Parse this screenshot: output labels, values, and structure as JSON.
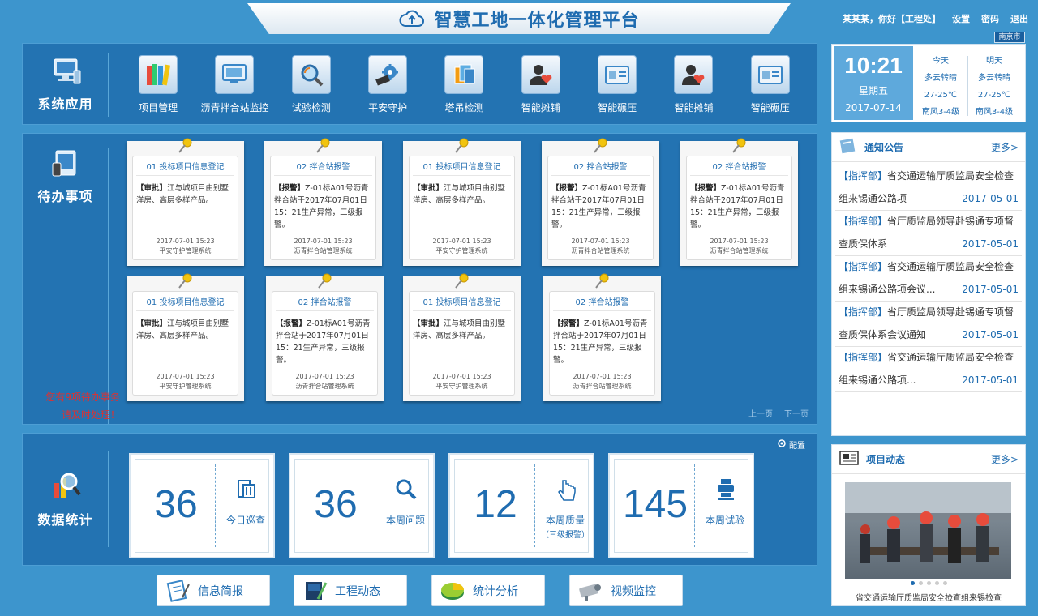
{
  "header": {
    "title": "智慧工地一体化管理平台",
    "user_greeting": "某某某，你好【工程处】",
    "settings": "设置",
    "password": "密码",
    "logout": "退出"
  },
  "apps_section": {
    "title": "系统应用",
    "items": [
      {
        "label": "项目管理",
        "icon": "books-icon"
      },
      {
        "label": "沥青拌合站监控",
        "icon": "monitor-icon"
      },
      {
        "label": "试验检测",
        "icon": "magnifier-icon"
      },
      {
        "label": "平安守护",
        "icon": "gear-icon"
      },
      {
        "label": "塔吊检测",
        "icon": "documents-icon"
      },
      {
        "label": "智能摊铺",
        "icon": "user-heart-icon"
      },
      {
        "label": "智能碾压",
        "icon": "id-card-icon"
      },
      {
        "label": "智能摊铺",
        "icon": "user-heart-icon"
      },
      {
        "label": "智能碾压",
        "icon": "id-card-icon"
      }
    ]
  },
  "todo_section": {
    "title": "待办事项",
    "pending_notice_line1": "您有9项待办事务",
    "pending_notice_line2": "请及时处理！",
    "prev_page": "上一页",
    "next_page": "下一页",
    "cards": [
      {
        "title": "01 投标项目信息登记",
        "tag": "【审批】",
        "text": "江与城项目由别墅洋房、高层多样产品。",
        "time": "2017-07-01 15:23",
        "source": "平安守护管理系统"
      },
      {
        "title": "02 拌合站报警",
        "tag": "【报警】",
        "text": "Z-01标A01号沥青拌合站于2017年07月01日 15：21生产异常，三级报警。",
        "time": "2017-07-01 15:23",
        "source": "沥青拌合站管理系统"
      },
      {
        "title": "01 投标项目信息登记",
        "tag": "【审批】",
        "text": "江与城项目由别墅洋房、高层多样产品。",
        "time": "2017-07-01 15:23",
        "source": "平安守护管理系统"
      },
      {
        "title": "02 拌合站报警",
        "tag": "【报警】",
        "text": "Z-01标A01号沥青拌合站于2017年07月01日 15：21生产异常，三级报警。",
        "time": "2017-07-01 15:23",
        "source": "沥青拌合站管理系统"
      },
      {
        "title": "02 拌合站报警",
        "tag": "【报警】",
        "text": "Z-01标A01号沥青拌合站于2017年07月01日 15：21生产异常，三级报警。",
        "time": "2017-07-01 15:23",
        "source": "沥青拌合站管理系统"
      },
      {
        "title": "01 投标项目信息登记",
        "tag": "【审批】",
        "text": "江与城项目由别墅洋房、高层多样产品。",
        "time": "2017-07-01 15:23",
        "source": "平安守护管理系统"
      },
      {
        "title": "02 拌合站报警",
        "tag": "【报警】",
        "text": "Z-01标A01号沥青拌合站于2017年07月01日 15：21生产异常，三级报警。",
        "time": "2017-07-01 15:23",
        "source": "沥青拌合站管理系统"
      },
      {
        "title": "01 投标项目信息登记",
        "tag": "【审批】",
        "text": "江与城项目由别墅洋房、高层多样产品。",
        "time": "2017-07-01 15:23",
        "source": "平安守护管理系统"
      },
      {
        "title": "02 拌合站报警",
        "tag": "【报警】",
        "text": "Z-01标A01号沥青拌合站于2017年07月01日 15：21生产异常，三级报警。",
        "time": "2017-07-01 15:23",
        "source": "沥青拌合站管理系统"
      }
    ]
  },
  "stats_section": {
    "title": "数据统计",
    "config": "配置",
    "items": [
      {
        "value": "36",
        "label": "今日巡查",
        "sub": "",
        "icon": "copy-icon"
      },
      {
        "value": "36",
        "label": "本周问题",
        "sub": "",
        "icon": "search-icon"
      },
      {
        "value": "12",
        "label": "本周质量",
        "sub": "（三级报警）",
        "icon": "hand-pointer-icon"
      },
      {
        "value": "145",
        "label": "本周试验",
        "sub": "",
        "icon": "printer-icon"
      }
    ]
  },
  "bottom_buttons": [
    {
      "label": "信息简报",
      "icon": "notebook-icon"
    },
    {
      "label": "工程动态",
      "icon": "book-icon"
    },
    {
      "label": "统计分析",
      "icon": "pie-chart-icon"
    },
    {
      "label": "视频监控",
      "icon": "camera-icon"
    }
  ],
  "weather": {
    "city": "南京市",
    "time": "10:21",
    "weekday": "星期五",
    "date": "2017-07-14",
    "today": {
      "label": "今天",
      "condition": "多云转晴",
      "temp": "27-25℃",
      "wind": "南风3-4级"
    },
    "tomorrow": {
      "label": "明天",
      "condition": "多云转晴",
      "temp": "27-25℃",
      "wind": "南风3-4级"
    }
  },
  "notices": {
    "title": "通知公告",
    "more": "更多>",
    "items": [
      {
        "tag": "【指挥部】",
        "line1": "省交通运输厅质监局安全检查",
        "line2": "组来锡通公路项",
        "date": "2017-05-01"
      },
      {
        "tag": "【指挥部】",
        "line1": "省厅质监局领导赴锡通专项督",
        "line2": "查质保体系",
        "date": "2017-05-01"
      },
      {
        "tag": "【指挥部】",
        "line1": "省交通运输厅质监局安全检查",
        "line2": "组来锡通公路项会议...",
        "date": "2017-05-01"
      },
      {
        "tag": "【指挥部】",
        "line1": "省厅质监局领导赴锡通专项督",
        "line2": "查质保体系会议通知",
        "date": "2017-05-01"
      },
      {
        "tag": "【指挥部】",
        "line1": "省交通运输厅质监局安全检查",
        "line2": "组来锡通公路项...",
        "date": "2017-05-01"
      }
    ]
  },
  "project_news": {
    "title": "项目动态",
    "more": "更多>",
    "caption": "省交通运输厅质监局安全检查组来锡检查"
  },
  "colors": {
    "background": "#3d95cd",
    "panel": "#2373b2",
    "accent": "#1f6cb0",
    "alert": "#e03030"
  }
}
